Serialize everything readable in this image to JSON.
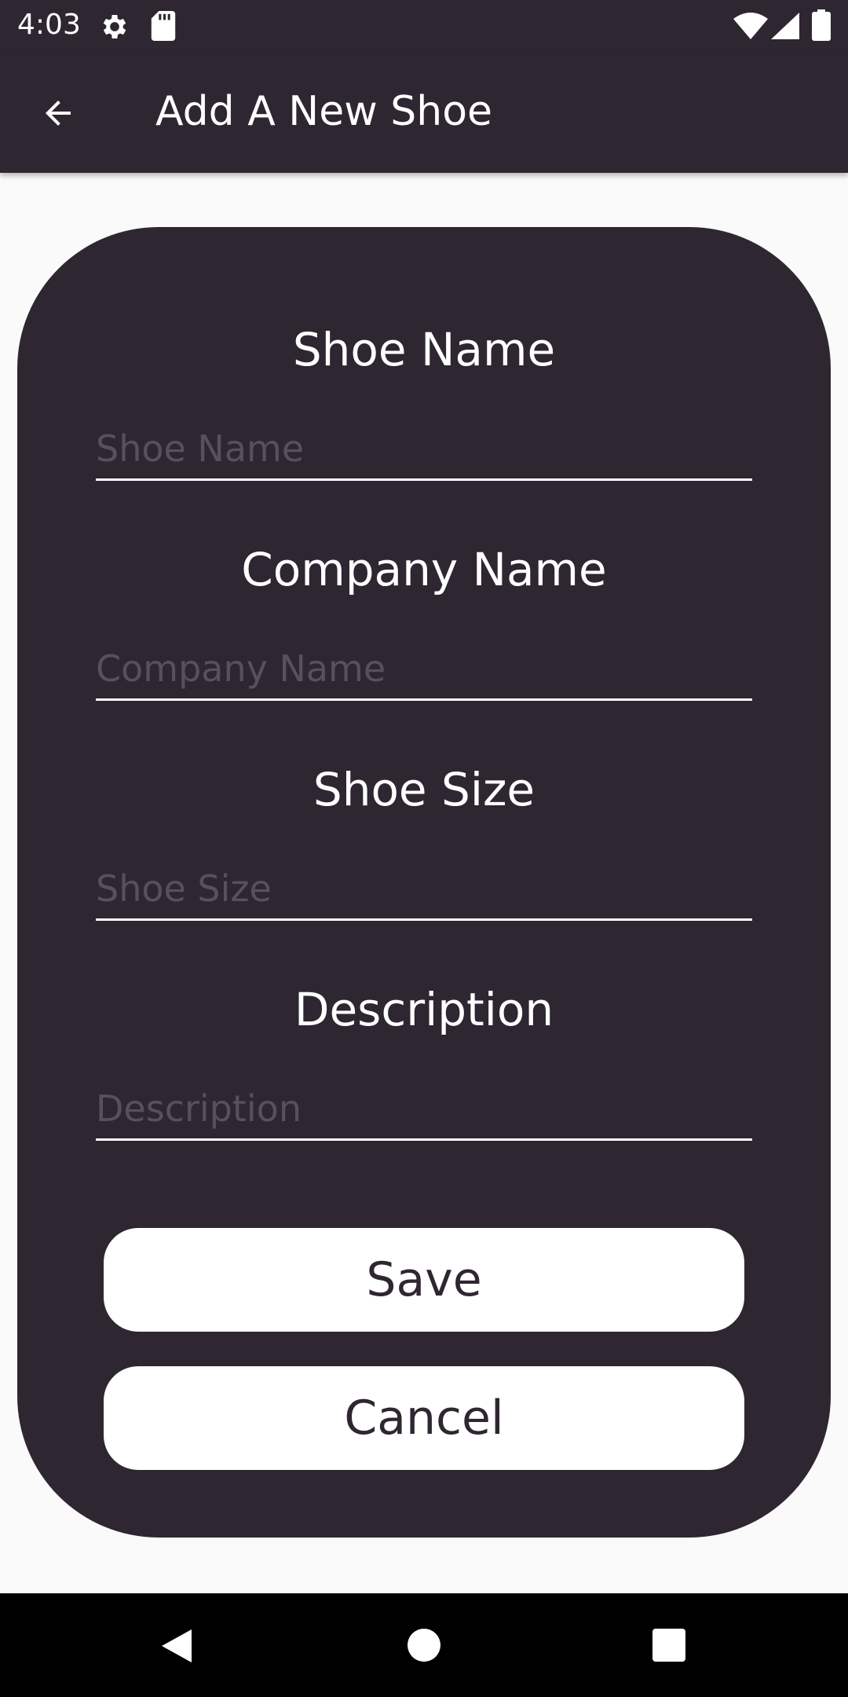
{
  "status_bar": {
    "time": "4:03",
    "icons": [
      "gear-icon",
      "sd-card-icon",
      "wifi-icon",
      "signal-icon",
      "battery-icon"
    ]
  },
  "app_bar": {
    "title": "Add A New Shoe",
    "back_icon": "arrow-back-icon"
  },
  "form": {
    "fields": [
      {
        "label": "Shoe Name",
        "value": "",
        "placeholder": "Shoe Name"
      },
      {
        "label": "Company Name",
        "value": "",
        "placeholder": "Company Name"
      },
      {
        "label": "Shoe Size",
        "value": "",
        "placeholder": "Shoe Size"
      },
      {
        "label": "Description",
        "value": "",
        "placeholder": "Description"
      }
    ],
    "save_label": "Save",
    "cancel_label": "Cancel"
  },
  "nav_bar": {
    "icons": [
      "back-triangle-icon",
      "home-circle-icon",
      "recents-square-icon"
    ]
  },
  "colors": {
    "primary": "#2e2630",
    "background": "#fafafa",
    "on_primary": "#ffffff",
    "placeholder": "#5a505c",
    "nav_bar": "#000000"
  }
}
